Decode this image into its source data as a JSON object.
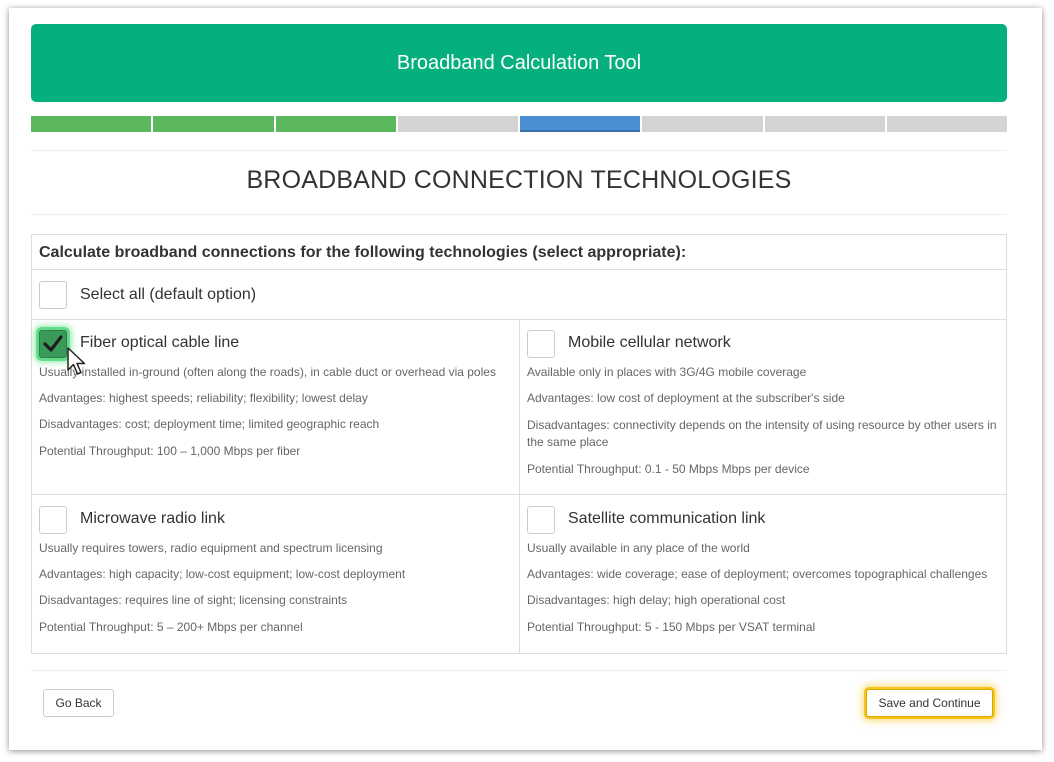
{
  "header": {
    "title": "Broadband Calculation Tool"
  },
  "progress": {
    "total_steps": 8,
    "completed_steps": 3,
    "current_step": 5
  },
  "colors": {
    "header": "#06b07e",
    "done": "#5cb85c",
    "active": "#4a8fd2",
    "todo": "#d4d4d4",
    "highlight": "#f5c518"
  },
  "page": {
    "title": "BROADBAND CONNECTION TECHNOLOGIES"
  },
  "panel": {
    "heading": "Calculate broadband connections for the following technologies (select appropriate):",
    "select_all": {
      "label": "Select all (default option)",
      "checked": false
    }
  },
  "technologies": [
    {
      "label": "Fiber optical cable line",
      "checked": true,
      "description": "Usually installed in-ground (often along the roads), in cable duct or overhead via poles",
      "advantages": "Advantages: highest speeds; reliability; flexibility; lowest delay",
      "disadvantages": "Disadvantages: cost; deployment time; limited geographic reach",
      "throughput": "Potential Throughput: 100 – 1,000 Mbps per fiber"
    },
    {
      "label": "Mobile cellular network",
      "checked": false,
      "description": "Available only in places with 3G/4G mobile coverage",
      "advantages": "Advantages: low cost of deployment at the subscriber's side",
      "disadvantages": "Disadvantages: connectivity depends on the intensity of using resource by other users in the same place",
      "throughput": "Potential Throughput: 0.1 - 50 Mbps Mbps per device"
    },
    {
      "label": "Microwave radio link",
      "checked": false,
      "description": "Usually requires towers, radio equipment and spectrum licensing",
      "advantages": "Advantages: high capacity; low-cost equipment; low-cost deployment",
      "disadvantages": "Disadvantages: requires line of sight; licensing constraints",
      "throughput": "Potential Throughput: 5 – 200+ Mbps per channel"
    },
    {
      "label": "Satellite communication link",
      "checked": false,
      "description": "Usually available in any place of the world",
      "advantages": "Advantages: wide coverage; ease of deployment; overcomes topographical challenges",
      "disadvantages": "Disadvantages: high delay; high operational cost",
      "throughput": "Potential Throughput: 5 - 150 Mbps per VSAT terminal"
    }
  ],
  "buttons": {
    "back": "Go Back",
    "save": "Save and Continue"
  }
}
